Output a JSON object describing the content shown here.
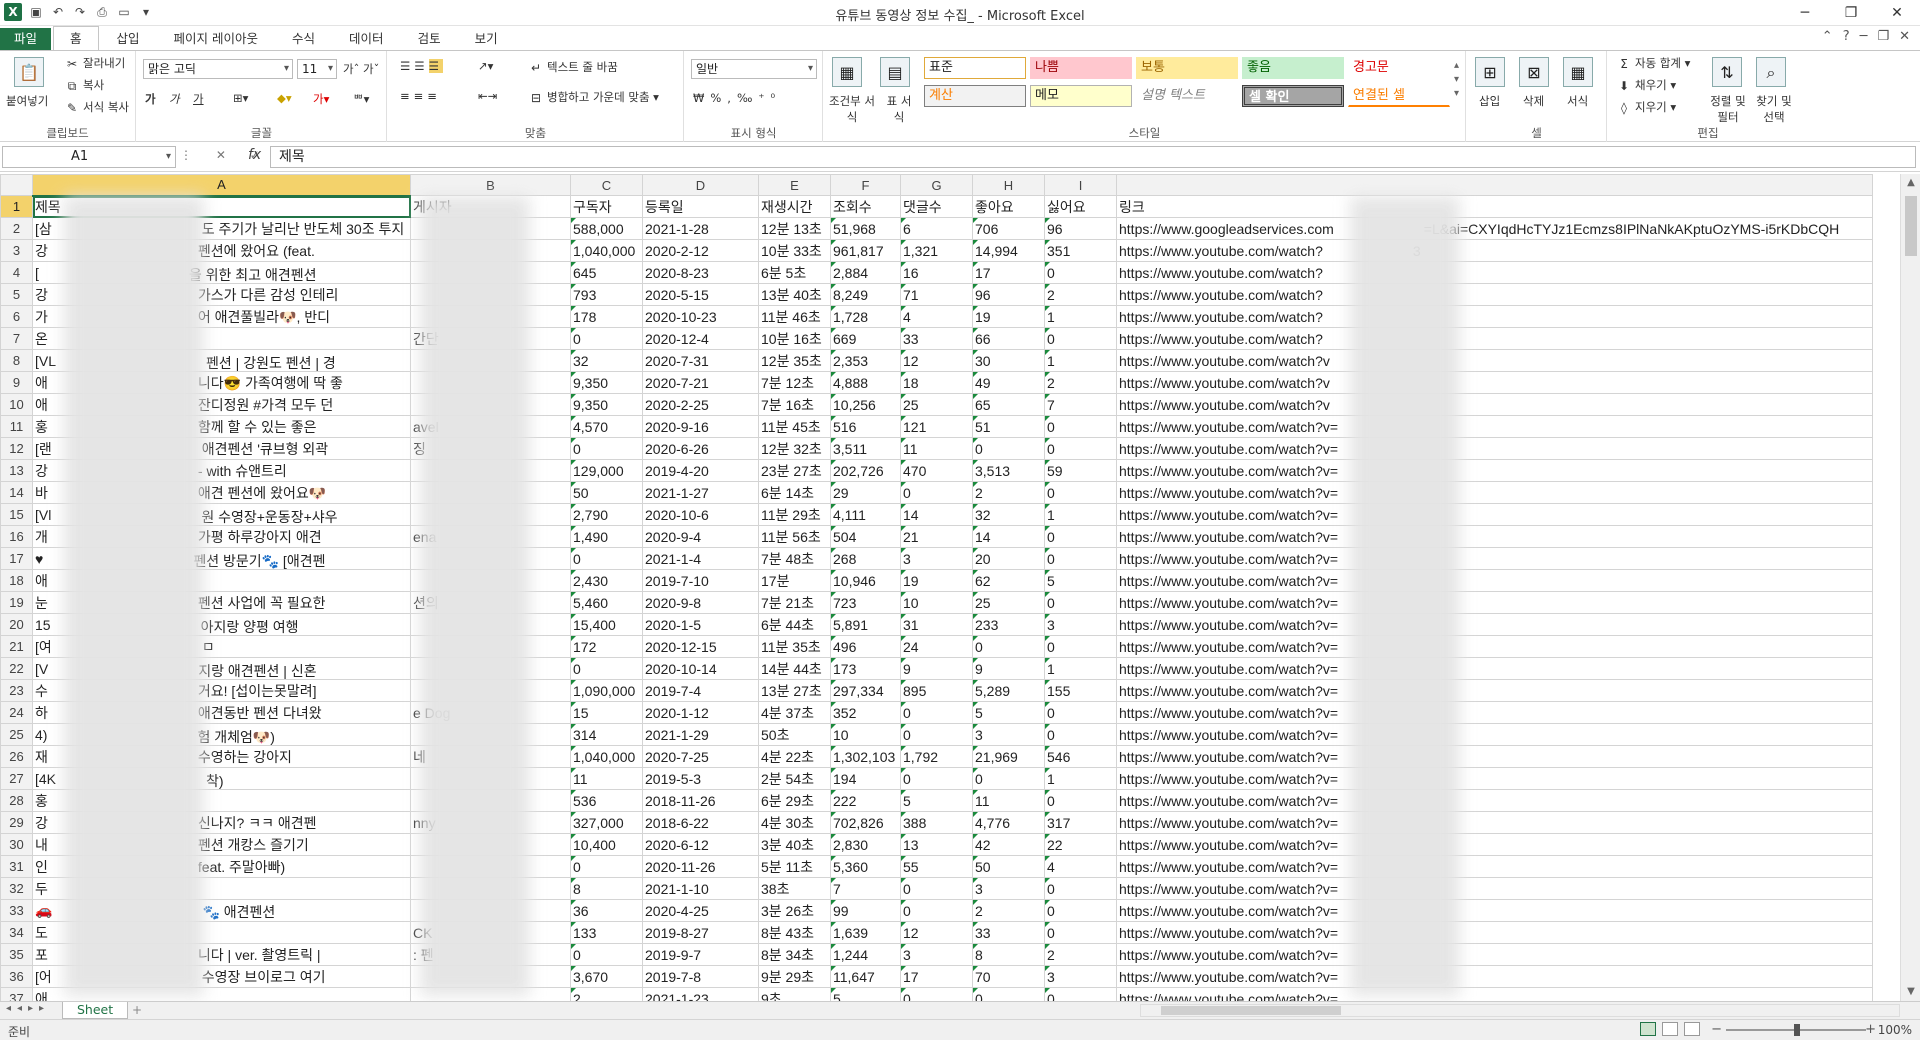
{
  "window": {
    "title": "유튜브 동영상 정보 수집_ - Microsoft Excel"
  },
  "tabs": [
    "파일",
    "홈",
    "삽입",
    "페이지 레이아웃",
    "수식",
    "데이터",
    "검토",
    "보기"
  ],
  "ribbon": {
    "clipboard": {
      "paste": "붙여넣기",
      "cut": "잘라내기",
      "copy": "복사",
      "format_painter": "서식 복사",
      "label": "클립보드"
    },
    "font": {
      "name": "맑은 고딕",
      "size": "11",
      "label": "글꼴",
      "bold": "가",
      "italic": "가",
      "underline": "가"
    },
    "alignment": {
      "wrap": "텍스트 줄 바꿈",
      "merge": "병합하고 가운데 맞춤",
      "label": "맞춤"
    },
    "number": {
      "format": "일반",
      "label": "표시 형식"
    },
    "styles": {
      "cond": "조건부 서식",
      "table": "표 서식",
      "cells": [
        "표준",
        "나쁨",
        "보통",
        "좋음",
        "경고문",
        "계산",
        "메모",
        "설명 텍스트",
        "셀 확인",
        "연결된 셀"
      ],
      "label": "스타일"
    },
    "cells": {
      "insert": "삽입",
      "delete": "삭제",
      "format": "서식",
      "label": "셀"
    },
    "editing": {
      "autosum": "자동 합계",
      "fill": "채우기",
      "clear": "지우기",
      "sort": "정렬 및 필터",
      "find": "찾기 및 선택",
      "label": "편집"
    }
  },
  "formula_bar": {
    "name_box": "A1",
    "fx": "fx",
    "value": "제목"
  },
  "columns": [
    "A",
    "B",
    "C",
    "D",
    "E",
    "F",
    "G",
    "H",
    "I"
  ],
  "rows": [
    {
      "a": "제목",
      "b": "게시자",
      "c": "구독자",
      "d": "등록일",
      "e": "재생시간",
      "f": "조회수",
      "g": "댓글수",
      "h": "좋아요",
      "i": "싫어요",
      "j": "링크"
    },
    {
      "a": "[삼",
      "b": "",
      "c": "588,000",
      "d": "2021-1-28",
      "e": "12분 13초",
      "f": "51,968",
      "g": "6",
      "h": "706",
      "i": "96",
      "j": "https://www.googleadservices.com",
      "j2": "=L&ai=CXYIqdHcTYJz1Ecmzs8IPlNaNkAKptuOzYMS-i5rKDbCQH",
      "mid": "도 주기가 날리난 반도체 30조 투지"
    },
    {
      "a": "강",
      "b": "",
      "c": "1,040,000",
      "d": "2020-2-12",
      "e": "10분 33초",
      "f": "961,817",
      "g": "1,321",
      "h": "14,994",
      "i": "351",
      "j": "https://www.youtube.com/watch?",
      "j2": "3",
      "mid": "펜션에 왔어요 (feat."
    },
    {
      "a": "[",
      "b": "",
      "c": "645",
      "d": "2020-8-23",
      "e": "6분 5초",
      "f": "2,884",
      "g": "16",
      "h": "17",
      "i": "0",
      "j": "https://www.youtube.com/watch?",
      "mid": "을 위한 최고 애견펜션"
    },
    {
      "a": "강",
      "b": "",
      "c": "793",
      "d": "2020-5-15",
      "e": "13분 40초",
      "f": "8,249",
      "g": "71",
      "h": "96",
      "i": "2",
      "j": "https://www.youtube.com/watch?",
      "mid": "가스가 다른 감성 인테리"
    },
    {
      "a": "가",
      "b": "",
      "c": "178",
      "d": "2020-10-23",
      "e": "11분 46초",
      "f": "1,728",
      "g": "4",
      "h": "19",
      "i": "1",
      "j": "https://www.youtube.com/watch?",
      "mid": "어 애견풀빌라🐶, 반디"
    },
    {
      "a": "온",
      "b": "간단",
      "c": "0",
      "d": "2020-12-4",
      "e": "10분 16초",
      "f": "669",
      "g": "33",
      "h": "66",
      "i": "0",
      "j": "https://www.youtube.com/watch?",
      "mid": ""
    },
    {
      "a": "[VL",
      "b": "",
      "c": "32",
      "d": "2020-7-31",
      "e": "12분 35초",
      "f": "2,353",
      "g": "12",
      "h": "30",
      "i": "1",
      "j": "https://www.youtube.com/watch?v",
      "mid": "펜션 | 강원도 펜션 | 경"
    },
    {
      "a": "애",
      "b": "",
      "c": "9,350",
      "d": "2020-7-21",
      "e": "7분 12초",
      "f": "4,888",
      "g": "18",
      "h": "49",
      "i": "2",
      "j": "https://www.youtube.com/watch?v",
      "mid": "니다😎 가족여행에 딱 좋"
    },
    {
      "a": "애",
      "b": "",
      "c": "9,350",
      "d": "2020-2-25",
      "e": "7분 16초",
      "f": "10,256",
      "g": "25",
      "h": "65",
      "i": "7",
      "j": "https://www.youtube.com/watch?v",
      "mid": "잔디정원 #가격 모두 던"
    },
    {
      "a": "홍",
      "b": "avel",
      "c": "4,570",
      "d": "2020-9-16",
      "e": "11분 45초",
      "f": "516",
      "g": "121",
      "h": "51",
      "i": "0",
      "j": "https://www.youtube.com/watch?v=",
      "mid": "함께 할 수 있는 좋은"
    },
    {
      "a": "[랜",
      "b": "징",
      "c": "0",
      "d": "2020-6-26",
      "e": "12분 32초",
      "f": "3,511",
      "g": "11",
      "h": "0",
      "i": "0",
      "j": "https://www.youtube.com/watch?v=",
      "mid": "애견펜션 '큐브형 외곽"
    },
    {
      "a": "강",
      "b": "",
      "c": "129,000",
      "d": "2019-4-20",
      "e": "23분 27초",
      "f": "202,726",
      "g": "470",
      "h": "3,513",
      "i": "59",
      "j": "https://www.youtube.com/watch?v=",
      "mid": "- with 슈앤트리"
    },
    {
      "a": "바",
      "b": "",
      "c": "50",
      "d": "2021-1-27",
      "e": "6분 14초",
      "f": "29",
      "g": "0",
      "h": "2",
      "i": "0",
      "j": "https://www.youtube.com/watch?v=",
      "mid": "애견 펜션에 왔어요🐶"
    },
    {
      "a": "[Vl",
      "b": "",
      "c": "2,790",
      "d": "2020-10-6",
      "e": "11분 29초",
      "f": "4,111",
      "g": "14",
      "h": "32",
      "i": "1",
      "j": "https://www.youtube.com/watch?v=",
      "mid": "원 수영장+운동장+샤우"
    },
    {
      "a": "개",
      "b": "ena",
      "c": "1,490",
      "d": "2020-9-4",
      "e": "11분 56초",
      "f": "504",
      "g": "21",
      "h": "14",
      "i": "0",
      "j": "https://www.youtube.com/watch?v=",
      "mid": "가평 하루강아지 애견"
    },
    {
      "a": "♥",
      "b": "",
      "c": "0",
      "d": "2021-1-4",
      "e": "7분 48초",
      "f": "268",
      "g": "3",
      "h": "20",
      "i": "0",
      "j": "https://www.youtube.com/watch?v=",
      "mid": "펜션 방문기🐾 [애견펜"
    },
    {
      "a": "애",
      "b": "",
      "c": "2,430",
      "d": "2019-7-10",
      "e": "17분",
      "f": "10,946",
      "g": "19",
      "h": "62",
      "i": "5",
      "j": "https://www.youtube.com/watch?v=",
      "mid": ""
    },
    {
      "a": "눈",
      "b": "션의",
      "c": "5,460",
      "d": "2020-9-8",
      "e": "7분 21초",
      "f": "723",
      "g": "10",
      "h": "25",
      "i": "0",
      "j": "https://www.youtube.com/watch?v=",
      "mid": "펜션 사업에 꼭 필요한"
    },
    {
      "a": "15",
      "b": "",
      "c": "15,400",
      "d": "2020-1-5",
      "e": "6분 44초",
      "f": "5,891",
      "g": "31",
      "h": "233",
      "i": "3",
      "j": "https://www.youtube.com/watch?v=",
      "mid": "아지랑 양평 여행"
    },
    {
      "a": "[여",
      "b": "",
      "c": "172",
      "d": "2020-12-15",
      "e": "11분 35초",
      "f": "496",
      "g": "24",
      "h": "0",
      "i": "0",
      "j": "https://www.youtube.com/watch?v=",
      "mid": "ㅁ"
    },
    {
      "a": "[V",
      "b": "",
      "c": "0",
      "d": "2020-10-14",
      "e": "14분 44초",
      "f": "173",
      "g": "9",
      "h": "9",
      "i": "1",
      "j": "https://www.youtube.com/watch?v=",
      "mid": "지랑 애견펜션 | 신혼"
    },
    {
      "a": "수",
      "b": "",
      "c": "1,090,000",
      "d": "2019-7-4",
      "e": "13분 27초",
      "f": "297,334",
      "g": "895",
      "h": "5,289",
      "i": "155",
      "j": "https://www.youtube.com/watch?v=",
      "mid": "거요! [섭이는못말려]"
    },
    {
      "a": "하",
      "b": "e Dog",
      "c": "15",
      "d": "2020-1-12",
      "e": "4분 37초",
      "f": "352",
      "g": "0",
      "h": "5",
      "i": "0",
      "j": "https://www.youtube.com/watch?v=",
      "mid": "애견동반 펜션 다녀왔"
    },
    {
      "a": "4)",
      "b": "",
      "c": "314",
      "d": "2021-1-29",
      "e": "50초",
      "f": "10",
      "g": "0",
      "h": "3",
      "i": "0",
      "j": "https://www.youtube.com/watch?v=",
      "mid": "험 개체엄🐶)"
    },
    {
      "a": "재",
      "b": "네",
      "c": "1,040,000",
      "d": "2020-7-25",
      "e": "4분 22초",
      "f": "1,302,103",
      "g": "1,792",
      "h": "21,969",
      "i": "546",
      "j": "https://www.youtube.com/watch?v=",
      "mid": "수영하는 강아지"
    },
    {
      "a": "[4K",
      "b": "",
      "c": "11",
      "d": "2019-5-3",
      "e": "2분 54초",
      "f": "194",
      "g": "0",
      "h": "0",
      "i": "1",
      "j": "https://www.youtube.com/watch?v=",
      "mid": "착)"
    },
    {
      "a": "홍",
      "b": "",
      "c": "536",
      "d": "2018-11-26",
      "e": "6분 29초",
      "f": "222",
      "g": "5",
      "h": "11",
      "i": "0",
      "j": "https://www.youtube.com/watch?v=",
      "mid": ""
    },
    {
      "a": "강",
      "b": "nny",
      "c": "327,000",
      "d": "2018-6-22",
      "e": "4분 30초",
      "f": "702,826",
      "g": "388",
      "h": "4,776",
      "i": "317",
      "j": "https://www.youtube.com/watch?v=",
      "mid": "신나지? ㅋㅋ 애견펜"
    },
    {
      "a": "내",
      "b": "",
      "c": "10,400",
      "d": "2020-6-12",
      "e": "3분 40초",
      "f": "2,830",
      "g": "13",
      "h": "42",
      "i": "22",
      "j": "https://www.youtube.com/watch?v=",
      "mid": "펜션 개캉스 즐기기"
    },
    {
      "a": "인",
      "b": "",
      "c": "0",
      "d": "2020-11-26",
      "e": "5분 11초",
      "f": "5,360",
      "g": "55",
      "h": "50",
      "i": "4",
      "j": "https://www.youtube.com/watch?v=",
      "mid": "feat. 주말아빠)"
    },
    {
      "a": "두",
      "b": "",
      "c": "8",
      "d": "2021-1-10",
      "e": "38초",
      "f": "7",
      "g": "0",
      "h": "3",
      "i": "0",
      "j": "https://www.youtube.com/watch?v=",
      "mid": ""
    },
    {
      "a": "🚗",
      "b": "",
      "c": "36",
      "d": "2020-4-25",
      "e": "3분 26초",
      "f": "99",
      "g": "0",
      "h": "2",
      "i": "0",
      "j": "https://www.youtube.com/watch?v=",
      "mid": "🐾 애견펜션"
    },
    {
      "a": "도",
      "b": "CK",
      "c": "133",
      "d": "2019-8-27",
      "e": "8분 43초",
      "f": "1,639",
      "g": "12",
      "h": "33",
      "i": "0",
      "j": "https://www.youtube.com/watch?v=",
      "mid": ""
    },
    {
      "a": "포",
      "b": ": 펜",
      "c": "0",
      "d": "2019-9-7",
      "e": "8분 34초",
      "f": "1,244",
      "g": "3",
      "h": "8",
      "i": "2",
      "j": "https://www.youtube.com/watch?v=",
      "mid": "니다 | ver. 촬영트릭 |"
    },
    {
      "a": "[어",
      "b": "",
      "c": "3,670",
      "d": "2019-7-8",
      "e": "9분 29초",
      "f": "11,647",
      "g": "17",
      "h": "70",
      "i": "3",
      "j": "https://www.youtube.com/watch?v=",
      "mid": "수영장 브이로그 여기"
    },
    {
      "a": "애",
      "b": "",
      "c": "2",
      "d": "2021-1-23",
      "e": "9초",
      "f": "5",
      "g": "0",
      "h": "0",
      "i": "0",
      "j": "https://www.youtube.com/watch?v=",
      "mid": ""
    }
  ],
  "sheet": {
    "name": "Sheet",
    "add": "+"
  },
  "status": {
    "ready": "준비",
    "zoom": "100%"
  }
}
